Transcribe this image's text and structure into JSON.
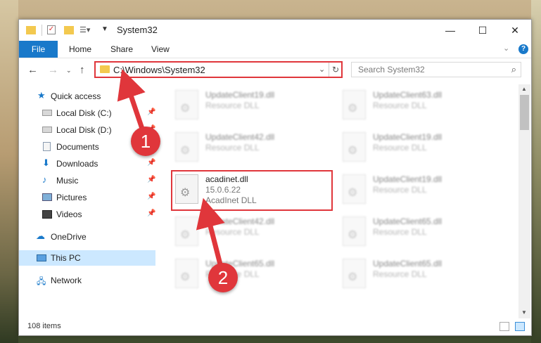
{
  "window": {
    "title": "System32",
    "minimize": "—",
    "maximize": "☐",
    "close": "✕"
  },
  "ribbon": {
    "tabs": [
      "File",
      "Home",
      "Share",
      "View"
    ],
    "help": "?"
  },
  "address": {
    "path": "C:\\Windows\\System32",
    "search_placeholder": "Search System32"
  },
  "sidebar": {
    "items": [
      {
        "label": "Quick access",
        "icon": "star-icon",
        "pinned": false
      },
      {
        "label": "Local Disk (C:)",
        "icon": "drive-icon",
        "pinned": true
      },
      {
        "label": "Local Disk (D:)",
        "icon": "drive-icon",
        "pinned": true
      },
      {
        "label": "Documents",
        "icon": "documents-icon",
        "pinned": true
      },
      {
        "label": "Downloads",
        "icon": "downloads-icon",
        "pinned": true
      },
      {
        "label": "Music",
        "icon": "music-icon",
        "pinned": true
      },
      {
        "label": "Pictures",
        "icon": "pictures-icon",
        "pinned": true
      },
      {
        "label": "Videos",
        "icon": "videos-icon",
        "pinned": true
      },
      {
        "label": "OneDrive",
        "icon": "onedrive-icon",
        "pinned": false
      },
      {
        "label": "This PC",
        "icon": "computer-icon",
        "pinned": false,
        "selected": true
      },
      {
        "label": "Network",
        "icon": "network-icon",
        "pinned": false
      }
    ]
  },
  "files": [
    {
      "name": "UpdateClient19.dll",
      "line1": "Resource DLL",
      "line2": ""
    },
    {
      "name": "UpdateClient63.dll",
      "line1": "Resource DLL",
      "line2": ""
    },
    {
      "name": "UpdateClient42.dll",
      "line1": "Resource DLL",
      "line2": ""
    },
    {
      "name": "UpdateClient19.dll",
      "line1": "Resource DLL",
      "line2": ""
    },
    {
      "name": "acadinet.dll",
      "line1": "15.0.6.22",
      "line2": "AcadInet DLL"
    },
    {
      "name": "UpdateClient19.dll",
      "line1": "Resource DLL",
      "line2": ""
    },
    {
      "name": "UpdateClient42.dll",
      "line1": "Resource DLL",
      "line2": ""
    },
    {
      "name": "UpdateClient65.dll",
      "line1": "Resource DLL",
      "line2": ""
    },
    {
      "name": "UpdateClient65.dll",
      "line1": "Resource DLL",
      "line2": ""
    },
    {
      "name": "UpdateClient65.dll",
      "line1": "Resource DLL",
      "line2": ""
    }
  ],
  "status": {
    "item_count": "108 items"
  },
  "annotations": {
    "step1": "1",
    "step2": "2",
    "color": "#e0363b"
  }
}
